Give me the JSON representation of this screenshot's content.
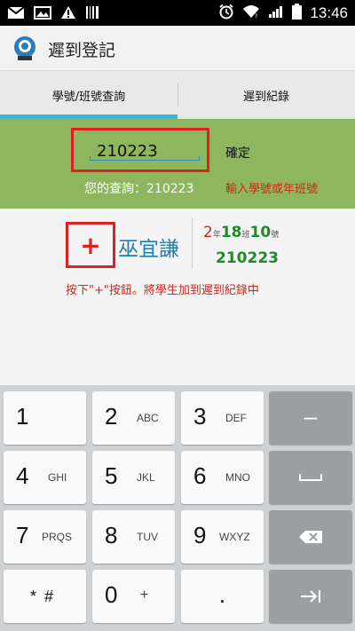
{
  "status_bar": {
    "time": "13:46",
    "left_icons": [
      "mail-icon",
      "image-icon",
      "warning-icon",
      "barcode-icon"
    ],
    "right_icons": [
      "alarm-icon",
      "wifi-icon",
      "signal-icon",
      "battery-icon"
    ]
  },
  "app": {
    "title": "遲到登記"
  },
  "tabs": [
    {
      "label": "學號/班號查詢",
      "selected": true
    },
    {
      "label": "遲到紀錄",
      "selected": false
    }
  ],
  "query": {
    "input_value": "210223",
    "confirm_label": "確定",
    "result_text": "您的查詢：210223",
    "hint": "輸入學號或年班號"
  },
  "student": {
    "add_label": "+",
    "name": "巫宜謙",
    "grade": "2",
    "grade_unit": "年",
    "class_no": "18",
    "class_unit": "班",
    "seat_no": "10",
    "seat_unit": "號",
    "student_id": "210223"
  },
  "instruction": "按下\"+\"按鈕。將學生加到遲到紀錄中",
  "keyboard": {
    "rows": [
      [
        {
          "digit": "1",
          "letters": ""
        },
        {
          "digit": "2",
          "letters": "ABC"
        },
        {
          "digit": "3",
          "letters": "DEF"
        },
        {
          "digit": "–",
          "letters": ""
        }
      ],
      [
        {
          "digit": "4",
          "letters": "GHI"
        },
        {
          "digit": "5",
          "letters": "JKL"
        },
        {
          "digit": "6",
          "letters": "MNO"
        },
        {
          "digit": "",
          "letters": ""
        }
      ],
      [
        {
          "digit": "7",
          "letters": "PRQS"
        },
        {
          "digit": "8",
          "letters": "TUV"
        },
        {
          "digit": "9",
          "letters": "WXYZ"
        },
        {
          "digit": "",
          "letters": ""
        }
      ],
      [
        {
          "digit": "*",
          "letters": "#"
        },
        {
          "digit": "0",
          "letters": "+"
        },
        {
          "digit": ".",
          "letters": ""
        },
        {
          "digit": "",
          "letters": ""
        }
      ]
    ],
    "special_keys": [
      "minus-key",
      "space-key",
      "backspace-key",
      "next-key"
    ]
  },
  "colors": {
    "accent": "#33b5e5",
    "green_panel": "#8db65f",
    "highlight_red": "#e02020",
    "name_blue": "#1e7fb0",
    "id_green": "#1f8a2a"
  }
}
